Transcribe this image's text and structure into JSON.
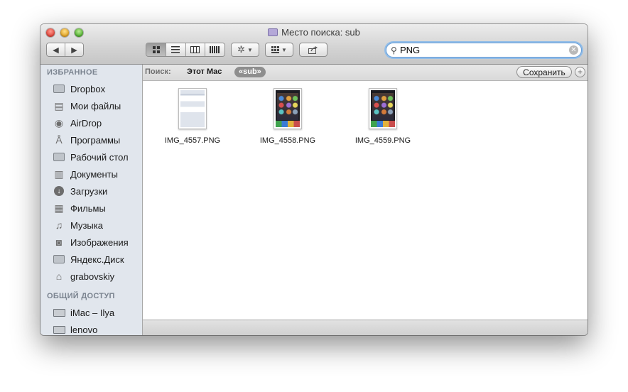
{
  "window": {
    "title": "Место поиска: sub"
  },
  "toolbar": {
    "back_icon": "chevron-left-icon",
    "forward_icon": "chevron-right-icon",
    "views": [
      "icon-view",
      "list-view",
      "column-view",
      "coverflow-view"
    ],
    "action_icon": "gear-icon",
    "arrange_icon": "grid-icon",
    "share_icon": "share-icon",
    "search": {
      "value": "PNG",
      "placeholder": ""
    }
  },
  "sidebar": {
    "favorites_header": "ИЗБРАННОЕ",
    "favorites": [
      {
        "label": "Dropbox",
        "icon": "folder-icon"
      },
      {
        "label": "Мои файлы",
        "icon": "all-files-icon"
      },
      {
        "label": "AirDrop",
        "icon": "airdrop-icon"
      },
      {
        "label": "Программы",
        "icon": "applications-icon"
      },
      {
        "label": "Рабочий стол",
        "icon": "desktop-icon"
      },
      {
        "label": "Документы",
        "icon": "documents-icon"
      },
      {
        "label": "Загрузки",
        "icon": "downloads-icon"
      },
      {
        "label": "Фильмы",
        "icon": "movies-icon"
      },
      {
        "label": "Музыка",
        "icon": "music-icon"
      },
      {
        "label": "Изображения",
        "icon": "pictures-icon"
      },
      {
        "label": "Яндекс.Диск",
        "icon": "folder-icon"
      },
      {
        "label": "grabovskiy",
        "icon": "home-icon"
      }
    ],
    "shared_header": "ОБЩИЙ ДОСТУП",
    "shared": [
      {
        "label": "iMac – Ilya",
        "icon": "computer-icon"
      },
      {
        "label": "lenovo",
        "icon": "computer-icon"
      }
    ]
  },
  "scope": {
    "label": "Поиск:",
    "this_mac": "Этот Mac",
    "folder": "«sub»",
    "save_label": "Сохранить",
    "add_label": "+"
  },
  "files": [
    {
      "name": "IMG_4557.PNG",
      "thumb": "settings-screenshot"
    },
    {
      "name": "IMG_4558.PNG",
      "thumb": "homescreen-screenshot"
    },
    {
      "name": "IMG_4559.PNG",
      "thumb": "homescreen-screenshot"
    }
  ]
}
